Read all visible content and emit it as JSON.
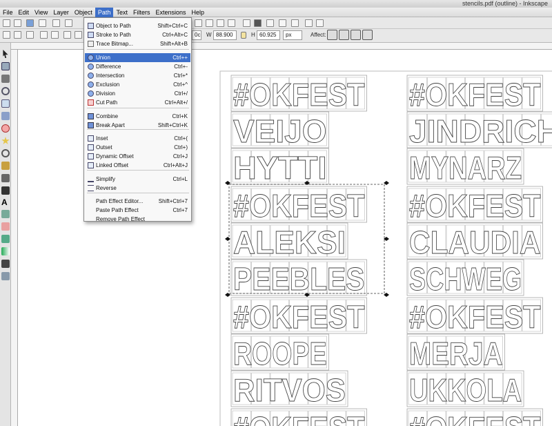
{
  "window": {
    "title": "stencils.pdf (outline) - Inkscape"
  },
  "menubar": {
    "items": [
      "File",
      "Edit",
      "View",
      "Layer",
      "Object",
      "Path",
      "Text",
      "Filters",
      "Extensions",
      "Help"
    ],
    "active": "Path"
  },
  "toolbar": {
    "w_label": "W",
    "w_value": "88.900",
    "h_label": "H",
    "h_value": "60.925",
    "x_value_tail": "0c",
    "unit": "px",
    "affect_label": "Affect:"
  },
  "path_menu": {
    "items": [
      {
        "label": "Object to Path",
        "shortcut": "Shift+Ctrl+C",
        "icon": "object-to-path-icon"
      },
      {
        "label": "Stroke to Path",
        "shortcut": "Ctrl+Alt+C",
        "icon": "stroke-to-path-icon"
      },
      {
        "label": "Trace Bitmap...",
        "shortcut": "Shift+Alt+B",
        "icon": "trace-bitmap-icon"
      },
      {
        "label": "Union",
        "shortcut": "Ctrl++",
        "icon": "union-icon"
      },
      {
        "label": "Difference",
        "shortcut": "Ctrl+-",
        "icon": "difference-icon"
      },
      {
        "label": "Intersection",
        "shortcut": "Ctrl+*",
        "icon": "intersection-icon"
      },
      {
        "label": "Exclusion",
        "shortcut": "Ctrl+^",
        "icon": "exclusion-icon"
      },
      {
        "label": "Division",
        "shortcut": "Ctrl+/",
        "icon": "division-icon"
      },
      {
        "label": "Cut Path",
        "shortcut": "Ctrl+Alt+/",
        "icon": "cut-path-icon"
      },
      {
        "label": "Combine",
        "shortcut": "Ctrl+K",
        "icon": "combine-icon"
      },
      {
        "label": "Break Apart",
        "shortcut": "Shift+Ctrl+K",
        "icon": "break-apart-icon"
      },
      {
        "label": "Inset",
        "shortcut": "Ctrl+(",
        "icon": "inset-icon"
      },
      {
        "label": "Outset",
        "shortcut": "Ctrl+)",
        "icon": "outset-icon"
      },
      {
        "label": "Dynamic Offset",
        "shortcut": "Ctrl+J",
        "icon": "dynamic-offset-icon"
      },
      {
        "label": "Linked Offset",
        "shortcut": "Ctrl+Alt+J",
        "icon": "linked-offset-icon"
      },
      {
        "label": "Simplify",
        "shortcut": "Ctrl+L",
        "icon": "simplify-icon"
      },
      {
        "label": "Reverse",
        "shortcut": "",
        "icon": "reverse-icon"
      },
      {
        "label": "Path Effect Editor...",
        "shortcut": "Shift+Ctrl+7",
        "icon": ""
      },
      {
        "label": "Paste Path Effect",
        "shortcut": "Ctrl+7",
        "icon": ""
      },
      {
        "label": "Remove Path Effect",
        "shortcut": "",
        "icon": ""
      }
    ],
    "highlighted": "Union"
  },
  "canvas": {
    "blocks": [
      {
        "lines": [
          "#OKFEST",
          "VEIJO",
          "HYTTI"
        ]
      },
      {
        "lines": [
          "#OKFEST",
          "JINDRICH",
          "MYNARZ"
        ]
      },
      {
        "lines": [
          "#OKFEST",
          "ALEKSI",
          "PEEBLES"
        ]
      },
      {
        "lines": [
          "#OKFEST",
          "CLAUDIA",
          "SCHWEG"
        ]
      },
      {
        "lines": [
          "#OKFEST",
          "ROOPE",
          "RITVOS"
        ]
      },
      {
        "lines": [
          "#OKFEST",
          "MERJA",
          "UKKOLA"
        ]
      },
      {
        "lines": [
          "#OKFEST"
        ]
      },
      {
        "lines": [
          "#OKFEST"
        ]
      }
    ]
  }
}
